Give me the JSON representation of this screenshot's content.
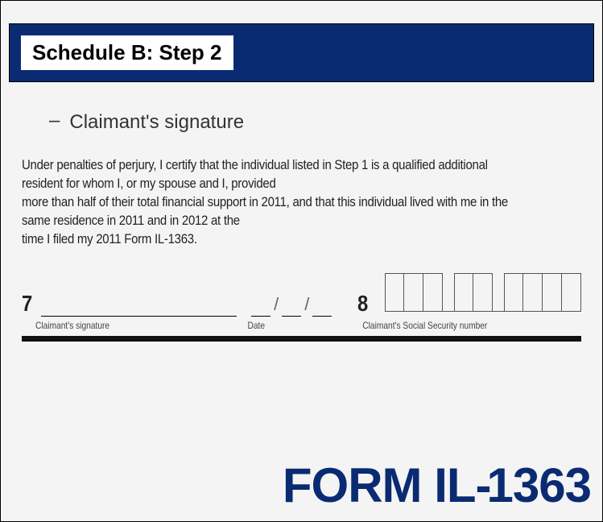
{
  "header": {
    "title": "Schedule B: Step 2"
  },
  "bullet": {
    "dash": "–",
    "text": "Claimant's signature"
  },
  "form": {
    "cert_line1": "Under penalties of perjury, I certify that the individual listed in Step 1 is a qualified additional resident for whom I, or my spouse and I, provided",
    "cert_line2": "more than half of their total financial support in 2011, and that this individual lived with me in the same residence in 2011 and in 2012 at the",
    "cert_line3": "time I filed my 2011 Form IL-1363.",
    "num7": "7",
    "num8": "8",
    "date_sep": "/",
    "label_signature": "Claimant's signature",
    "label_date": "Date",
    "label_ssn": "Claimant's Social Security number"
  },
  "footer": {
    "text_a": "FORM IL",
    "text_b": "-",
    "text_c": "1363"
  }
}
